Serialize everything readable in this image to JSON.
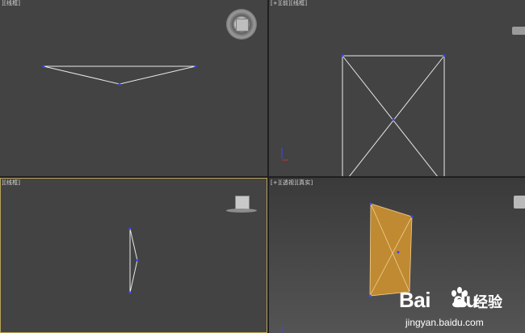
{
  "viewports": {
    "top": {
      "label": "[线框]",
      "label_prefix": "]"
    },
    "front": {
      "label": "[+][前][线框]"
    },
    "left": {
      "label": "[线框]",
      "label_prefix": "]"
    },
    "perspective": {
      "label": "[+][透视][真实]"
    }
  },
  "colors": {
    "viewport_bg": "#434343",
    "perspective_bg_top": "#3a3a3a",
    "perspective_bg_bottom": "#545454",
    "wire": "#e8e8e8",
    "vertex": "#3b46ff",
    "mesh_fill": "#c08a32",
    "active_border": "#b8a35a"
  },
  "icons": [
    "viewcube-icon",
    "viewcube-icon",
    "viewcube-icon",
    "baidu-paw-icon"
  ],
  "watermark": {
    "brand_a": "Bai",
    "brand_b": "du",
    "cn": "经验",
    "url": "jingyan.baidu.com"
  }
}
